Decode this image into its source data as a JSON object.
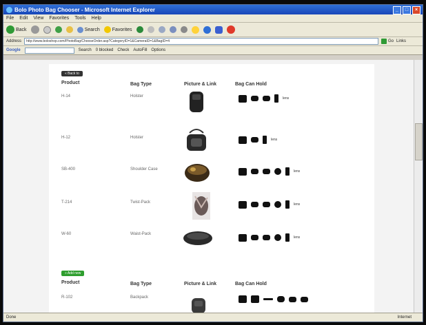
{
  "window": {
    "title": "Bolo Photo Bag Chooser - Microsoft Internet Explorer"
  },
  "menu": [
    "File",
    "Edit",
    "View",
    "Favorites",
    "Tools",
    "Help"
  ],
  "toolbar": {
    "back": "Back",
    "search": "Search",
    "favorites": "Favorites"
  },
  "address": {
    "label": "Address",
    "url": "http://www.boloshop.com/PhotoBag/ChooseOrder.asp?CategoryID=1&CameraID=1&BagID=4",
    "go": "Go",
    "links": "Links"
  },
  "google": {
    "label": "Google",
    "search_label": "Search",
    "blocked": "0 blocked",
    "check": "Check",
    "autofill": "AutoFill",
    "options": "Options"
  },
  "page": {
    "back_button": "« Back  to",
    "add_button": "» Add new",
    "headers": {
      "product": "Product",
      "bag_type": "Bag Type",
      "picture": "Picture & Link",
      "can_hold": "Bag Can Hold"
    },
    "section1": [
      {
        "product": "H-14",
        "bag_type": "Holster",
        "more": "lens"
      },
      {
        "product": "H-12",
        "bag_type": "Holster",
        "more": "lens"
      },
      {
        "product": "SB-400",
        "bag_type": "Shoulder Case",
        "more": "lens"
      },
      {
        "product": "T-214",
        "bag_type": "Twist-Pack",
        "more": "lens"
      },
      {
        "product": "W-60",
        "bag_type": "Waist-Pack",
        "more": "lens"
      }
    ],
    "section2": [
      {
        "product": "R-102",
        "bag_type": "Backpack"
      }
    ]
  },
  "status": {
    "left": "Done",
    "right": "Internet"
  }
}
